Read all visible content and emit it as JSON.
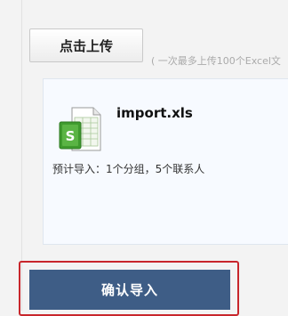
{
  "upload": {
    "button_label": "点击上传",
    "hint": "( 一次最多上传100个Excel文"
  },
  "file": {
    "icon": "excel-spreadsheet-icon",
    "name": "import.xls",
    "summary": "预计导入：1个分组，5个联系人"
  },
  "actions": {
    "confirm_label": "确认导入",
    "confirm_color": "#3e5d86",
    "highlight_color": "#c8262c"
  }
}
